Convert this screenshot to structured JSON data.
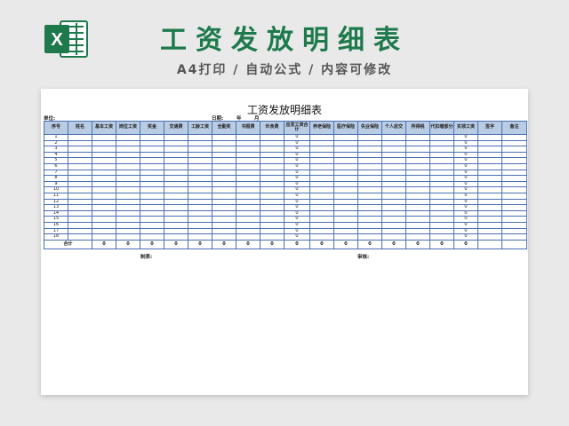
{
  "banner": {
    "logo_letter": "X",
    "logo_color": "#1e7a4d",
    "title": "工资发放明细表",
    "subtitle": "A4打印 / 自动公式 / 内容可修改"
  },
  "sheet": {
    "title": "工资发放明细表",
    "unit_label": "单位:",
    "date_label": "日期:",
    "year_label": "年",
    "month_label": "月",
    "header_bg": "#b8cce4",
    "border_color": "#4a6fb2",
    "columns": [
      "序号",
      "姓名",
      "基本工资",
      "岗位工资",
      "奖金",
      "交通费",
      "工龄工资",
      "全勤奖",
      "书报费",
      "伙食费",
      "应发工资合计",
      "养老保险",
      "医疗保险",
      "失业保险",
      "个人房交",
      "所得税",
      "代扣缴部分",
      "实领工资",
      "签字",
      "备注"
    ],
    "highlight_columns": [
      10,
      17
    ],
    "rows": [
      [
        "1",
        "",
        "",
        "",
        "",
        "",
        "",
        "",
        "",
        "",
        "0",
        "",
        "",
        "",
        "",
        "",
        "",
        "0",
        "",
        ""
      ],
      [
        "2",
        "",
        "",
        "",
        "",
        "",
        "",
        "",
        "",
        "",
        "0",
        "",
        "",
        "",
        "",
        "",
        "",
        "0",
        "",
        ""
      ],
      [
        "3",
        "",
        "",
        "",
        "",
        "",
        "",
        "",
        "",
        "",
        "0",
        "",
        "",
        "",
        "",
        "",
        "",
        "0",
        "",
        ""
      ],
      [
        "4",
        "",
        "",
        "",
        "",
        "",
        "",
        "",
        "",
        "",
        "0",
        "",
        "",
        "",
        "",
        "",
        "",
        "0",
        "",
        ""
      ],
      [
        "5",
        "",
        "",
        "",
        "",
        "",
        "",
        "",
        "",
        "",
        "0",
        "",
        "",
        "",
        "",
        "",
        "",
        "0",
        "",
        ""
      ],
      [
        "6",
        "",
        "",
        "",
        "",
        "",
        "",
        "",
        "",
        "",
        "0",
        "",
        "",
        "",
        "",
        "",
        "",
        "0",
        "",
        ""
      ],
      [
        "7",
        "",
        "",
        "",
        "",
        "",
        "",
        "",
        "",
        "",
        "0",
        "",
        "",
        "",
        "",
        "",
        "",
        "0",
        "",
        ""
      ],
      [
        "8",
        "",
        "",
        "",
        "",
        "",
        "",
        "",
        "",
        "",
        "0",
        "",
        "",
        "",
        "",
        "",
        "",
        "0",
        "",
        ""
      ],
      [
        "9",
        "",
        "",
        "",
        "",
        "",
        "",
        "",
        "",
        "",
        "0",
        "",
        "",
        "",
        "",
        "",
        "",
        "0",
        "",
        ""
      ],
      [
        "10",
        "",
        "",
        "",
        "",
        "",
        "",
        "",
        "",
        "",
        "0",
        "",
        "",
        "",
        "",
        "",
        "",
        "0",
        "",
        ""
      ],
      [
        "11",
        "",
        "",
        "",
        "",
        "",
        "",
        "",
        "",
        "",
        "0",
        "",
        "",
        "",
        "",
        "",
        "",
        "0",
        "",
        ""
      ],
      [
        "12",
        "",
        "",
        "",
        "",
        "",
        "",
        "",
        "",
        "",
        "0",
        "",
        "",
        "",
        "",
        "",
        "",
        "0",
        "",
        ""
      ],
      [
        "13",
        "",
        "",
        "",
        "",
        "",
        "",
        "",
        "",
        "",
        "0",
        "",
        "",
        "",
        "",
        "",
        "",
        "0",
        "",
        ""
      ],
      [
        "14",
        "",
        "",
        "",
        "",
        "",
        "",
        "",
        "",
        "",
        "0",
        "",
        "",
        "",
        "",
        "",
        "",
        "0",
        "",
        ""
      ],
      [
        "15",
        "",
        "",
        "",
        "",
        "",
        "",
        "",
        "",
        "",
        "0",
        "",
        "",
        "",
        "",
        "",
        "",
        "0",
        "",
        ""
      ],
      [
        "16",
        "",
        "",
        "",
        "",
        "",
        "",
        "",
        "",
        "",
        "0",
        "",
        "",
        "",
        "",
        "",
        "",
        "0",
        "",
        ""
      ],
      [
        "17",
        "",
        "",
        "",
        "",
        "",
        "",
        "",
        "",
        "",
        "0",
        "",
        "",
        "",
        "",
        "",
        "",
        "0",
        "",
        ""
      ],
      [
        "18",
        "",
        "",
        "",
        "",
        "",
        "",
        "",
        "",
        "",
        "0",
        "",
        "",
        "",
        "",
        "",
        "",
        "0",
        "",
        ""
      ]
    ],
    "total_label": "合计",
    "total_values": [
      "0",
      "0",
      "0",
      "0",
      "0",
      "0",
      "0",
      "0",
      "0",
      "0",
      "0",
      "0",
      "0",
      "0",
      "0",
      "0"
    ],
    "maker_label": "制表:",
    "reviewer_label": "审核:"
  }
}
